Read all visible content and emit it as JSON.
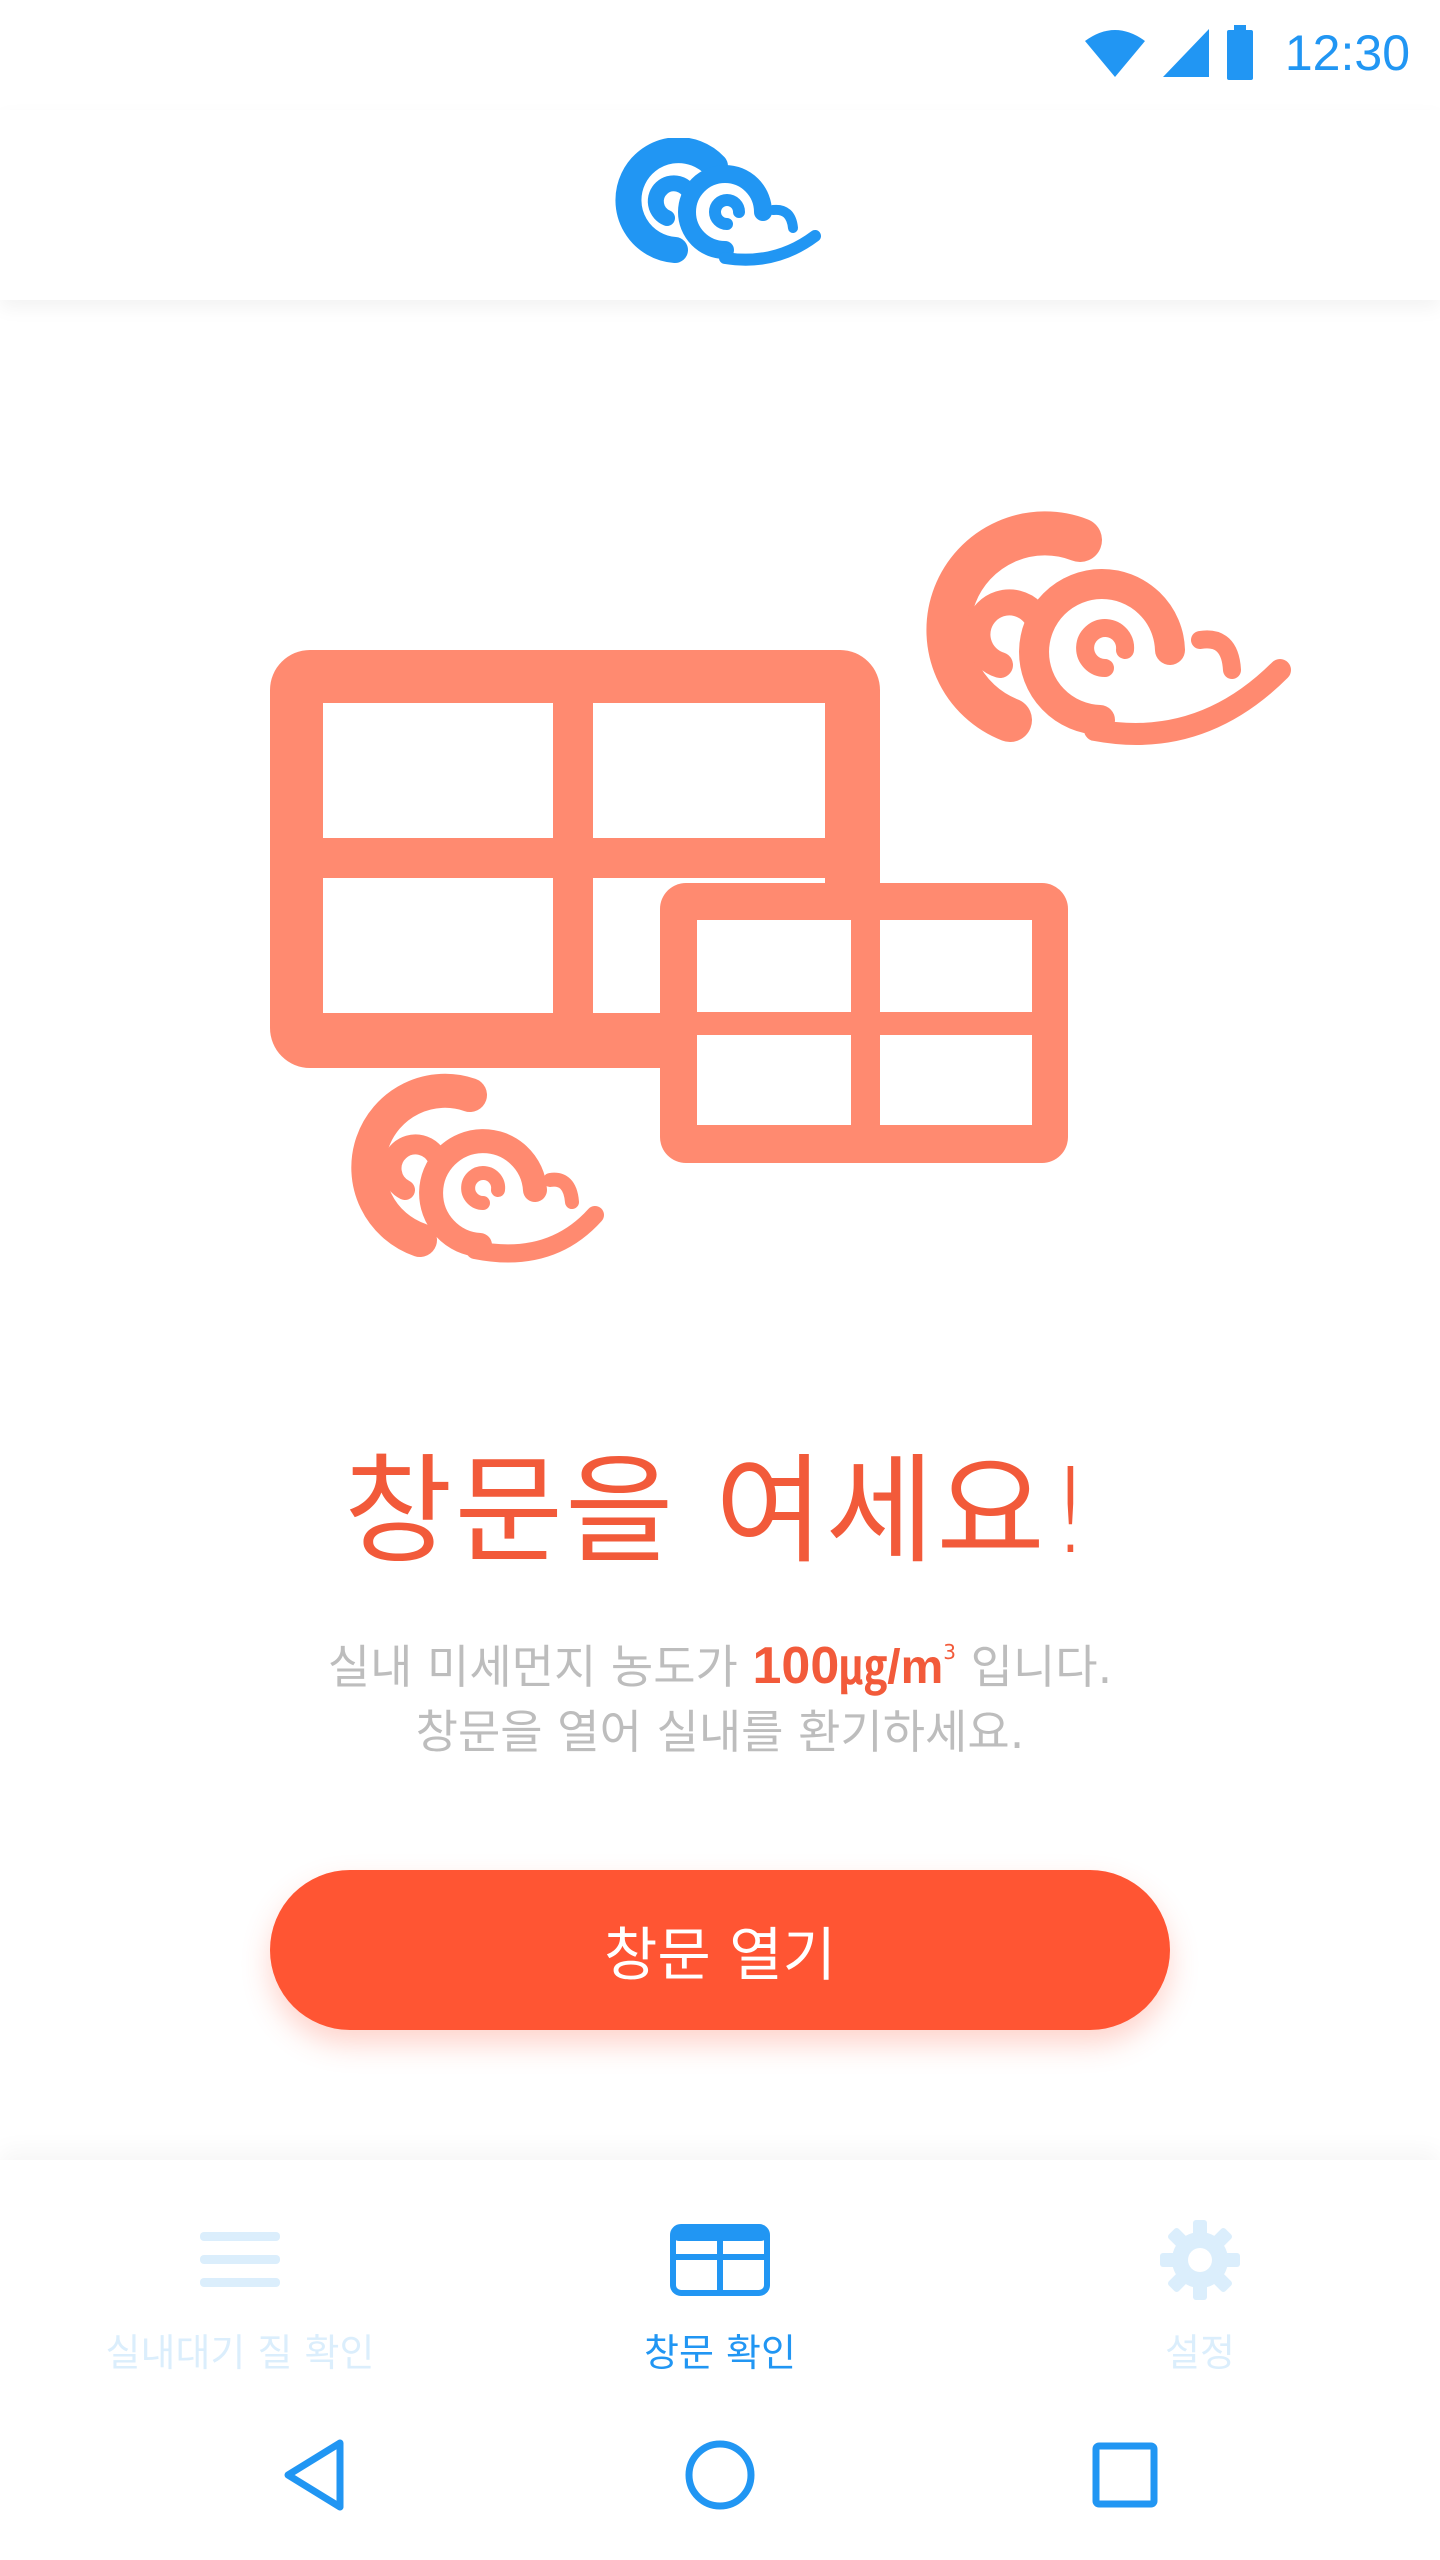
{
  "status_bar": {
    "time": "12:30",
    "icons": [
      "wifi-icon",
      "cell-signal-icon",
      "battery-icon"
    ],
    "accent_color": "#2196F3"
  },
  "header": {
    "logo_icon": "cloud-logo-icon",
    "logo_color": "#2196F3"
  },
  "main": {
    "illustration_icons": [
      "window-icon",
      "cloud-icon"
    ],
    "illustration_color": "#FF8A70",
    "headline": "창문을 여세요!",
    "description": {
      "line1_prefix": "실내 미세먼지 농도가",
      "value": "100",
      "unit": "㎍/m",
      "unit_superscript": "3",
      "line1_suffix": "입니다.",
      "line2": "창문을 열어 실내를 환기하세요."
    },
    "open_button_label": "창문 열기",
    "accent_color": "#FF5533"
  },
  "bottom_nav": {
    "items": [
      {
        "label": "실내대기 질 확인",
        "icon": "menu-icon",
        "active": false
      },
      {
        "label": "창문 확인",
        "icon": "window-icon",
        "active": true
      },
      {
        "label": "설정",
        "icon": "gear-icon",
        "active": false
      }
    ],
    "active_color": "#2196F3",
    "inactive_color": "#DBEEFC"
  },
  "system_nav": {
    "buttons": [
      "back-icon",
      "home-icon",
      "recents-icon"
    ]
  }
}
